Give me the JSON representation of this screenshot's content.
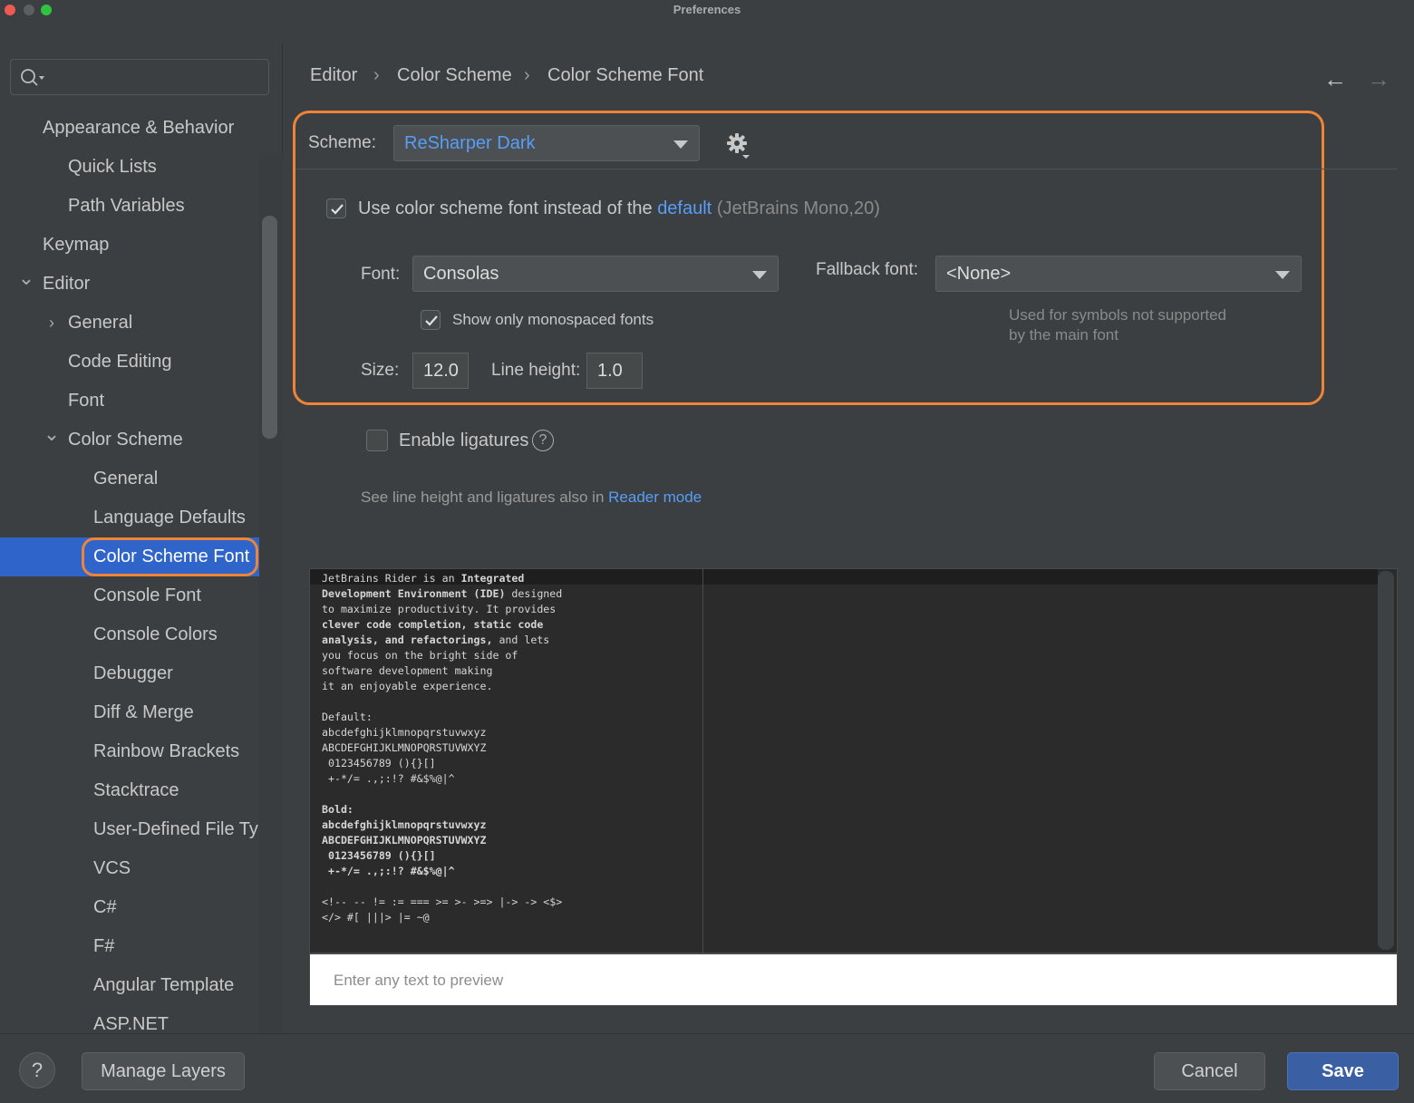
{
  "window": {
    "title": "Preferences"
  },
  "sidebar": {
    "search": {
      "value": "",
      "placeholder": ""
    },
    "items": [
      {
        "label": "Appearance & Behavior",
        "level": 0,
        "chevron": ""
      },
      {
        "label": "Quick Lists",
        "level": 1,
        "chevron": ""
      },
      {
        "label": "Path Variables",
        "level": 1,
        "chevron": ""
      },
      {
        "label": "Keymap",
        "level": 0,
        "chevron": ""
      },
      {
        "label": "Editor",
        "level": 0,
        "chevron": "expanded"
      },
      {
        "label": "General",
        "level": 1,
        "chevron": "collapsed"
      },
      {
        "label": "Code Editing",
        "level": 1,
        "chevron": ""
      },
      {
        "label": "Font",
        "level": 1,
        "chevron": ""
      },
      {
        "label": "Color Scheme",
        "level": 1,
        "chevron": "expanded"
      },
      {
        "label": "General",
        "level": 2,
        "chevron": ""
      },
      {
        "label": "Language Defaults",
        "level": 2,
        "chevron": ""
      },
      {
        "label": "Color Scheme Font",
        "level": 2,
        "chevron": "",
        "selected": true
      },
      {
        "label": "Console Font",
        "level": 2,
        "chevron": ""
      },
      {
        "label": "Console Colors",
        "level": 2,
        "chevron": ""
      },
      {
        "label": "Debugger",
        "level": 2,
        "chevron": ""
      },
      {
        "label": "Diff & Merge",
        "level": 2,
        "chevron": ""
      },
      {
        "label": "Rainbow Brackets",
        "level": 2,
        "chevron": ""
      },
      {
        "label": "Stacktrace",
        "level": 2,
        "chevron": ""
      },
      {
        "label": "User-Defined File Ty",
        "level": 2,
        "chevron": ""
      },
      {
        "label": "VCS",
        "level": 2,
        "chevron": ""
      },
      {
        "label": "C#",
        "level": 2,
        "chevron": ""
      },
      {
        "label": "F#",
        "level": 2,
        "chevron": ""
      },
      {
        "label": "Angular Template",
        "level": 2,
        "chevron": ""
      },
      {
        "label": "ASP.NET",
        "level": 2,
        "chevron": ""
      }
    ]
  },
  "breadcrumb": {
    "part1": "Editor",
    "part2": "Color Scheme",
    "part3": "Color Scheme Font",
    "separator": "›"
  },
  "nav": {
    "back": "←",
    "forward": "→"
  },
  "scheme": {
    "label": "Scheme:",
    "value": "ReSharper Dark"
  },
  "use_scheme_font": {
    "checked": true,
    "text": "Use color scheme font instead of the",
    "link": "default",
    "hint": "(JetBrains Mono,20)"
  },
  "font": {
    "label": "Font:",
    "value": "Consolas"
  },
  "fallback": {
    "label": "Fallback font:",
    "value": "<None>",
    "hint_line1": "Used for symbols not supported",
    "hint_line2": "by the main font"
  },
  "monospaced": {
    "checked": true,
    "label": "Show only monospaced fonts"
  },
  "size": {
    "label": "Size:",
    "value": "12.0"
  },
  "line_height": {
    "label": "Line height:",
    "value": "1.0"
  },
  "ligatures": {
    "checked": false,
    "label": "Enable ligatures",
    "help": "?"
  },
  "reader_note": {
    "text": "See line height and ligatures also in",
    "link": "Reader mode"
  },
  "preview": {
    "lines": [
      {
        "parts": [
          [
            "JetBrains Rider is an ",
            false
          ],
          [
            "Integrated",
            true
          ]
        ]
      },
      {
        "parts": [
          [
            "Development Environment (IDE)",
            true
          ],
          [
            " designed",
            false
          ]
        ]
      },
      {
        "parts": [
          [
            "to maximize productivity. It provides",
            false
          ]
        ]
      },
      {
        "parts": [
          [
            "clever code completion, static code",
            true
          ]
        ]
      },
      {
        "parts": [
          [
            "analysis, and refactorings,",
            true
          ],
          [
            " and lets",
            false
          ]
        ]
      },
      {
        "parts": [
          [
            "you focus on the bright side of",
            false
          ]
        ]
      },
      {
        "parts": [
          [
            "software development making",
            false
          ]
        ]
      },
      {
        "parts": [
          [
            "it an enjoyable experience.",
            false
          ]
        ]
      },
      {
        "parts": [
          [
            "",
            false
          ]
        ]
      },
      {
        "parts": [
          [
            "Default:",
            false
          ]
        ]
      },
      {
        "parts": [
          [
            "abcdefghijklmnopqrstuvwxyz",
            false
          ]
        ]
      },
      {
        "parts": [
          [
            "ABCDEFGHIJKLMNOPQRSTUVWXYZ",
            false
          ]
        ]
      },
      {
        "parts": [
          [
            " 0123456789 (){}[]",
            false
          ]
        ]
      },
      {
        "parts": [
          [
            " +-*/= .,;:!? #&$%@|^",
            false
          ]
        ]
      },
      {
        "parts": [
          [
            "",
            false
          ]
        ]
      },
      {
        "parts": [
          [
            "Bold:",
            true
          ]
        ]
      },
      {
        "parts": [
          [
            "abcdefghijklmnopqrstuvwxyz",
            true
          ]
        ]
      },
      {
        "parts": [
          [
            "ABCDEFGHIJKLMNOPQRSTUVWXYZ",
            true
          ]
        ]
      },
      {
        "parts": [
          [
            " 0123456789 (){}[]",
            true
          ]
        ]
      },
      {
        "parts": [
          [
            " +-*/= .,;:!? #&$%@|^",
            true
          ]
        ]
      },
      {
        "parts": [
          [
            "",
            false
          ]
        ]
      },
      {
        "parts": [
          [
            "<!-- -- != := === >= >- >=> |-> -> <$>",
            false
          ]
        ]
      },
      {
        "parts": [
          [
            "</> #[ |||> |= ~@",
            false
          ]
        ]
      }
    ],
    "input_placeholder": "Enter any text to preview"
  },
  "buttons": {
    "help": "?",
    "manage_layers": "Manage Layers",
    "cancel": "Cancel",
    "save": "Save"
  },
  "colors": {
    "accent": "#2f65ca",
    "highlight": "#f08436",
    "link": "#589df6",
    "primary_button": "#3b5fa3"
  }
}
